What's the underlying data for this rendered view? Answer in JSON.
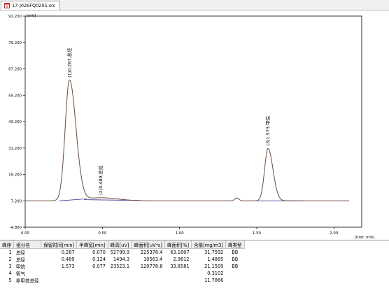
{
  "window": {
    "tab_title": "17-J026FQ0205.src"
  },
  "colors": {
    "signal": "#6b4a3c",
    "baseline": "#1a1a80",
    "axis": "#000000",
    "zero_line": "#c83c3c"
  },
  "chart_data": {
    "type": "line",
    "y_unit_label": "[mV]",
    "x_unit_label": "[Unit: min]",
    "ylim": [
      -4.8,
      91.2
    ],
    "xlim": [
      0,
      2.18
    ],
    "y_ticks": [
      "91.200",
      "79.200",
      "67.200",
      "55.200",
      "43.200",
      "31.200",
      "19.200",
      "7.200",
      "-4.800"
    ],
    "x_ticks": [
      "0.00",
      "0.50",
      "1.00",
      "1.50",
      "2.00"
    ],
    "baseline_level": 7.2,
    "peaks": [
      {
        "label": "(1)0.287,总烃",
        "retention_time": 0.287,
        "height_mv": 62.0,
        "sigma_left": 0.028,
        "sigma_right": 0.042
      },
      {
        "label": "(2)0.489,总烃",
        "retention_time": 0.489,
        "height_mv": 8.6,
        "sigma_left": 0.09,
        "sigma_right": 0.11
      },
      {
        "label": "",
        "retention_time": 1.37,
        "height_mv": 8.5,
        "sigma_left": 0.012,
        "sigma_right": 0.014
      },
      {
        "label": "(3)1.573,甲烷",
        "retention_time": 1.573,
        "height_mv": 31.0,
        "sigma_left": 0.022,
        "sigma_right": 0.032
      }
    ],
    "baselines": [
      {
        "from": [
          0.22,
          7.2
        ],
        "to": [
          0.4,
          8.1
        ]
      },
      {
        "from": [
          0.38,
          7.7
        ],
        "to": [
          0.74,
          7.4
        ]
      },
      {
        "from": [
          1.5,
          7.2
        ],
        "to": [
          1.8,
          7.2
        ]
      }
    ]
  },
  "table": {
    "headers": [
      "峰序",
      "组分名",
      "保留时间[min]",
      "半峰宽[min]",
      "峰高[uV]",
      "峰面积[uV*s]",
      "峰面积[%]",
      "含量[mg/m3]",
      "峰类型"
    ],
    "rows": [
      [
        "1",
        "总烃",
        "0.287",
        "0.070",
        "52799.9",
        "225378.4",
        "63.1807",
        "31.7592",
        "BB"
      ],
      [
        "2",
        "总烃",
        "0.489",
        "0.124",
        "1494.3",
        "10563.4",
        "2.9612",
        "1.4885",
        "BB"
      ],
      [
        "3",
        "甲烷",
        "1.573",
        "0.077",
        "23523.1",
        "120778.6",
        "33.8581",
        "21.1509",
        "BB"
      ],
      [
        "4",
        "氧气",
        "",
        "",
        "",
        "",
        "",
        "0.3102",
        ""
      ],
      [
        "5",
        "非甲烷总烃",
        "",
        "",
        "",
        "",
        "",
        "11.7866",
        ""
      ]
    ]
  }
}
